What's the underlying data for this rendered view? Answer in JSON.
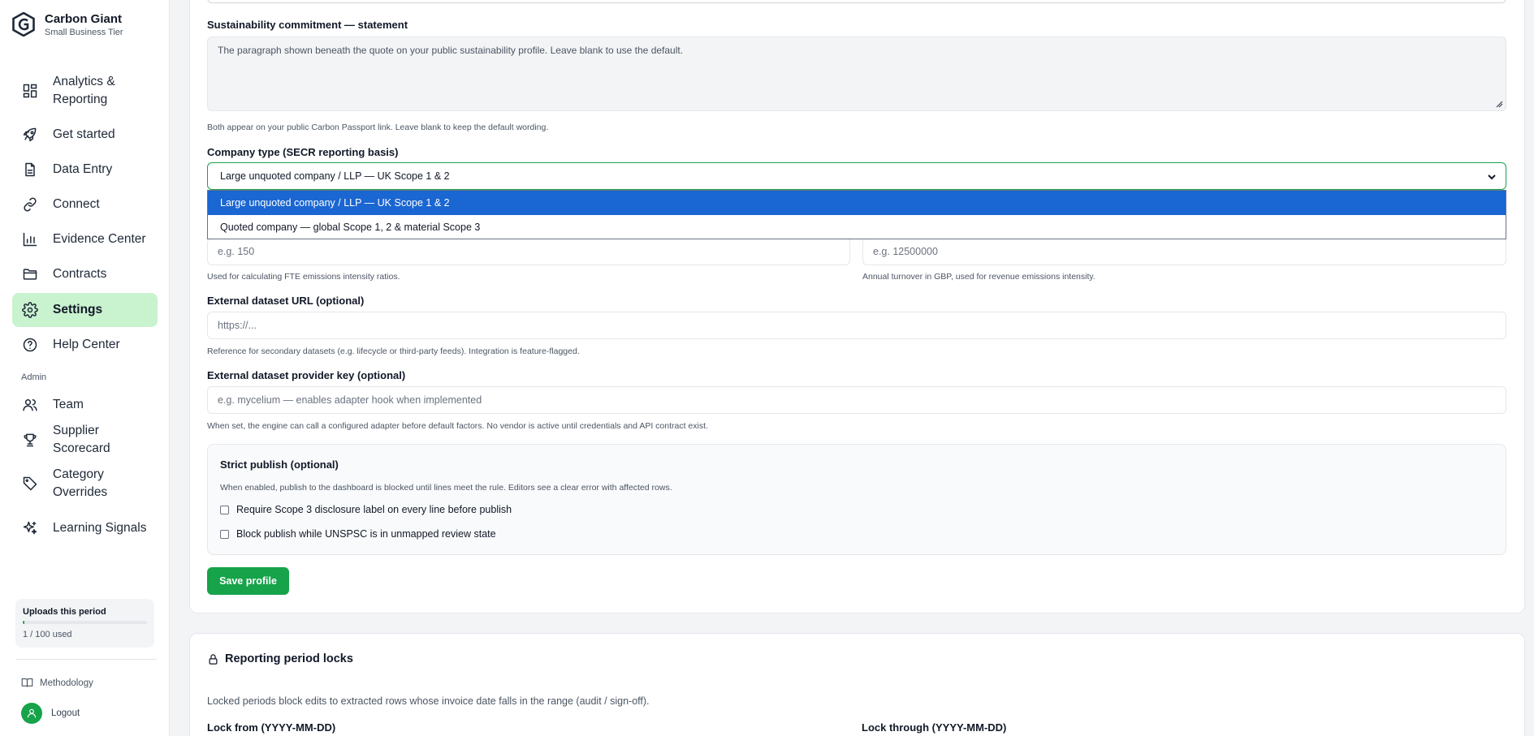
{
  "brand": {
    "name": "Carbon Giant",
    "tier": "Small Business Tier"
  },
  "nav": {
    "items": [
      {
        "label_line1": "Analytics &",
        "label_line2": "Reporting",
        "icon": "dashboard-icon"
      },
      {
        "label": "Get started",
        "icon": "rocket-icon"
      },
      {
        "label": "Data Entry",
        "icon": "document-icon"
      },
      {
        "label": "Connect",
        "icon": "link-icon"
      },
      {
        "label": "Evidence Center",
        "icon": "bar-chart-icon"
      },
      {
        "label": "Contracts",
        "icon": "folder-icon"
      },
      {
        "label": "Settings",
        "icon": "gear-icon",
        "active": true
      },
      {
        "label": "Help Center",
        "icon": "help-circle-icon"
      }
    ],
    "admin_label": "Admin",
    "admin_items": [
      {
        "label": "Team",
        "icon": "users-icon"
      },
      {
        "label": "Supplier Scorecard",
        "icon": "trophy-icon"
      },
      {
        "label_line1": "Category",
        "label_line2": "Overrides",
        "icon": "tag-icon"
      },
      {
        "label": "Learning Signals",
        "icon": "sparkles-icon"
      }
    ]
  },
  "usage": {
    "title": "Uploads this period",
    "text": "1 / 100 used",
    "fraction": 0.01
  },
  "footer": {
    "methodology": "Methodology",
    "logout": "Logout"
  },
  "form": {
    "statement_label": "Sustainability commitment — statement",
    "statement_placeholder": "The paragraph shown beneath the quote on your public sustainability profile. Leave blank to use the default.",
    "passport_help": "Both appear on your public Carbon Passport link. Leave blank to keep the default wording.",
    "company_type_label": "Company type (SECR reporting basis)",
    "company_type_value": "Large unquoted company / LLP — UK Scope 1 & 2",
    "company_type_options": [
      "Large unquoted company / LLP — UK Scope 1 & 2",
      "Quoted company — global Scope 1, 2 & material Scope 3"
    ],
    "employees_placeholder": "e.g. 150",
    "employees_help": "Used for calculating FTE emissions intensity ratios.",
    "turnover_placeholder": "e.g. 12500000",
    "turnover_help": "Annual turnover in GBP, used for revenue emissions intensity.",
    "dataset_url_label": "External dataset URL (optional)",
    "dataset_url_placeholder": "https://...",
    "dataset_url_help": "Reference for secondary datasets (e.g. lifecycle or third-party feeds). Integration is feature-flagged.",
    "provider_key_label": "External dataset provider key (optional)",
    "provider_key_placeholder": "e.g. mycelium — enables adapter hook when implemented",
    "provider_key_help": "When set, the engine can call a configured adapter before default factors. No vendor is active until credentials and API contract exist.",
    "strict_title": "Strict publish (optional)",
    "strict_desc": "When enabled, publish to the dashboard is blocked until lines meet the rule. Editors see a clear error with affected rows.",
    "strict_opt1": "Require Scope 3 disclosure label on every line before publish",
    "strict_opt2": "Block publish while UNSPSC is in unmapped review state",
    "save_label": "Save profile"
  },
  "locks": {
    "title": "Reporting period locks",
    "desc": "Locked periods block edits to extracted rows whose invoice date falls in the range (audit / sign-off).",
    "from_label": "Lock from (YYYY-MM-DD)",
    "through_label": "Lock through (YYYY-MM-DD)"
  },
  "colors": {
    "accent": "#16a34a",
    "active_nav_bg": "#c9f2cf",
    "option_highlight": "#1a66d2"
  }
}
